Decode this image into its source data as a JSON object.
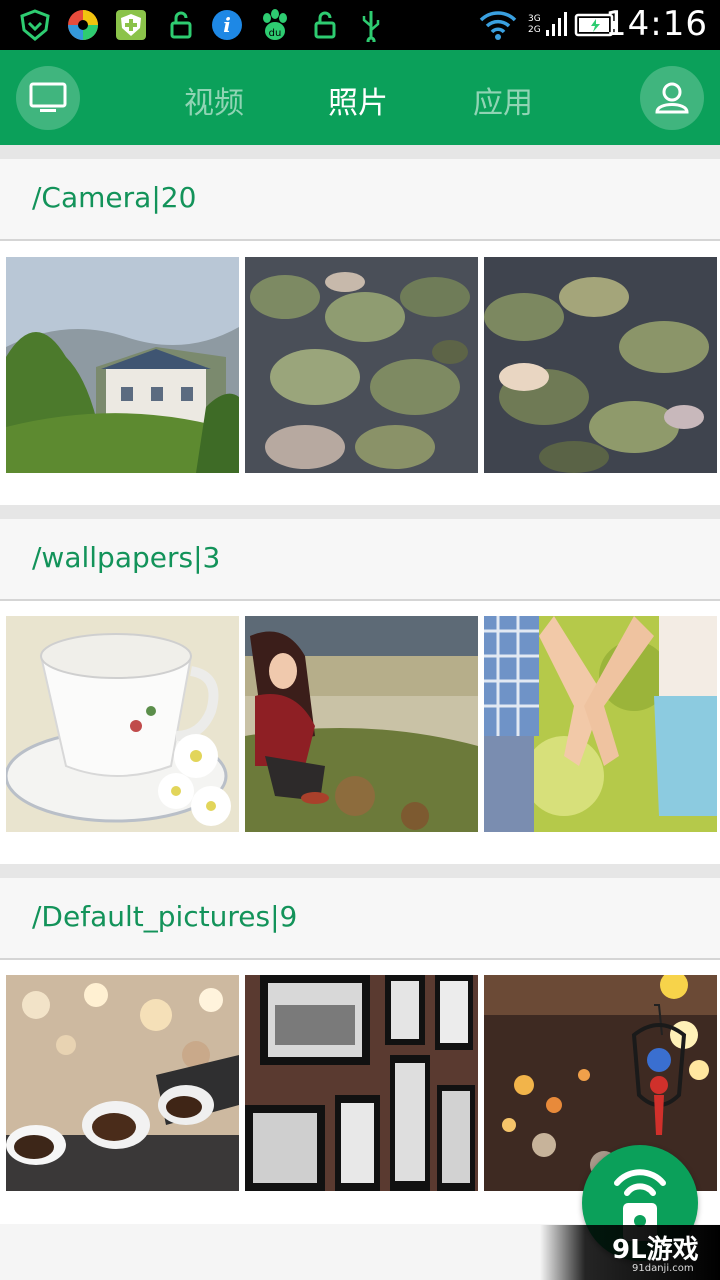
{
  "status_bar": {
    "time": "14:16",
    "network_top": "3G",
    "network_bottom": "2G",
    "icons": [
      "shield-icon",
      "color-wheel-icon",
      "security-plus-icon",
      "unlock-icon",
      "info-icon",
      "baidu-paw-icon",
      "unlock-icon",
      "usb-icon",
      "wifi-icon",
      "signal-icon",
      "battery-icon"
    ]
  },
  "app_bar": {
    "tabs": [
      {
        "label": "视频",
        "active": false
      },
      {
        "label": "照片",
        "active": true
      },
      {
        "label": "应用",
        "active": false
      }
    ],
    "left_icon": "tv-icon",
    "right_icon": "user-icon"
  },
  "sections": [
    {
      "title": "/Camera|20",
      "thumbnails": [
        "house-photo",
        "ivy-leaves-photo",
        "ivy-leaves-photo-2"
      ]
    },
    {
      "title": "/wallpapers|3",
      "thumbnails": [
        "teacup-photo",
        "girl-sitting-photo",
        "holding-hands-photo"
      ]
    },
    {
      "title": "/Default_pictures|9",
      "thumbnails": [
        "coffee-cups-photo",
        "framed-photos-wall",
        "bar-lamp-photo"
      ]
    }
  ],
  "fab": {
    "icon": "remote-wifi-icon"
  },
  "watermark": {
    "brand": "9L游戏",
    "url": "91danji.com"
  },
  "colors": {
    "brand_green": "#0ba05a",
    "title_green": "#13935a"
  }
}
